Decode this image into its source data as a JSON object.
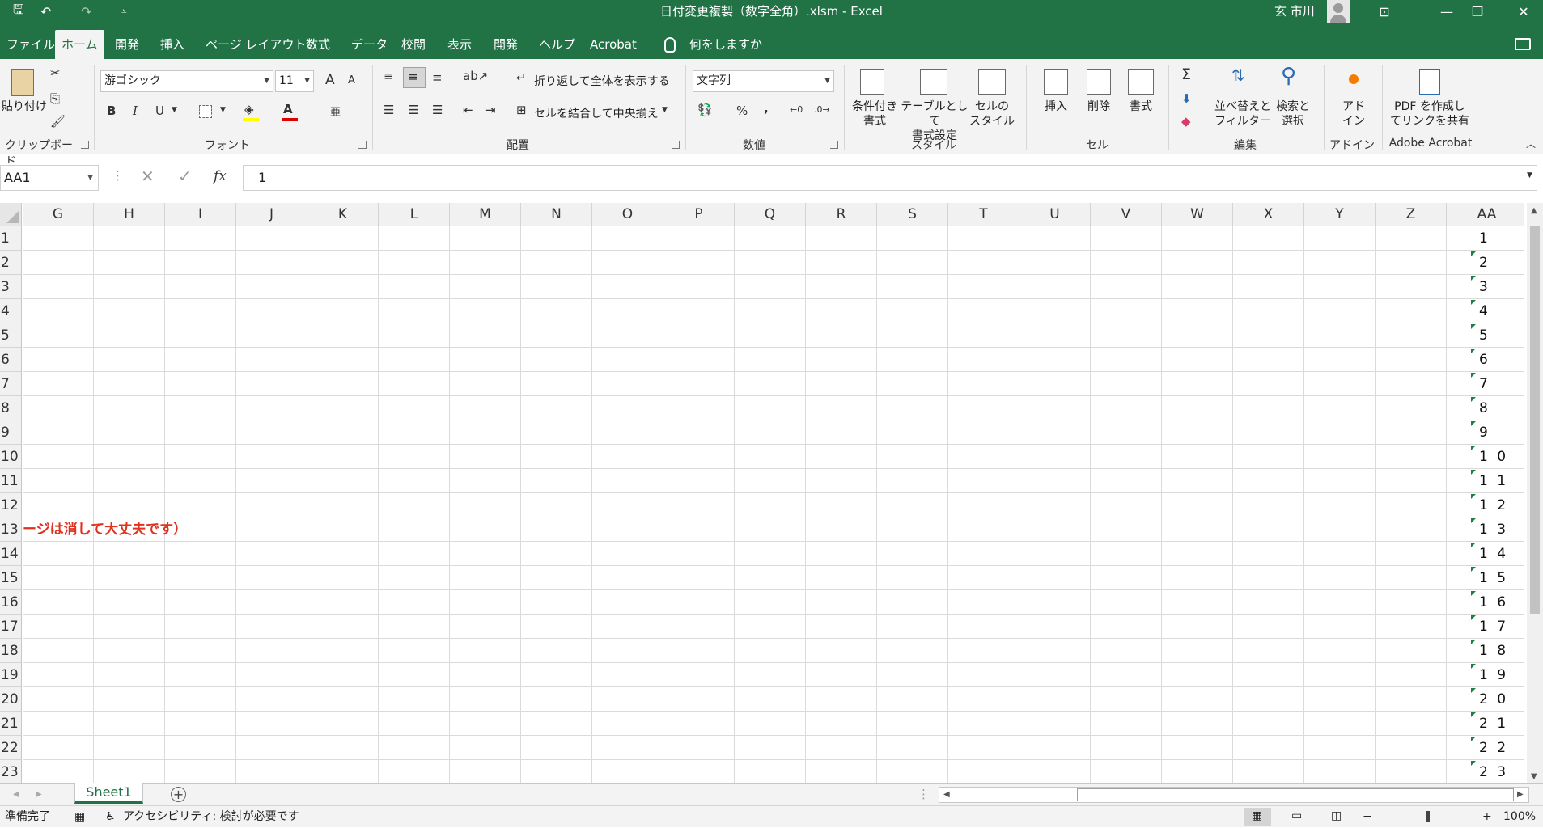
{
  "titlebar": {
    "title": "日付変更複製（数字全角）.xlsm  -  Excel",
    "user": "玄 市川",
    "qa_save": "🖫",
    "qa_undo": "↶",
    "qa_redo": "↷",
    "qa_more": "⩡",
    "win_ribbon_opts": "⊡",
    "win_minimize": "—",
    "win_restore": "❐",
    "win_close": "✕"
  },
  "tabs": [
    "ファイル",
    "ホーム",
    "開発",
    "挿入",
    "ページ レイアウト",
    "数式",
    "データ",
    "校閲",
    "表示",
    "開発",
    "ヘルプ",
    "Acrobat"
  ],
  "tell_me": "何をしますか",
  "ribbon": {
    "clipboard": {
      "paste": "貼り付け",
      "label": "クリップボード"
    },
    "font": {
      "name": "游ゴシック",
      "size": "11",
      "grow": "A",
      "shrink": "A",
      "bold": "B",
      "italic": "I",
      "underline": "U",
      "label": "フォント"
    },
    "alignment": {
      "wrap": "折り返して全体を表示する",
      "merge": "セルを結合して中央揃え",
      "label": "配置"
    },
    "number": {
      "format": "文字列",
      "percent": "%",
      "comma": ",",
      "label": "数値"
    },
    "styles": {
      "conditional": "条件付き\n書式",
      "table": "テーブルとして\n書式設定",
      "cell_styles": "セルの\nスタイル",
      "label": "スタイル"
    },
    "cells": {
      "insert": "挿入",
      "delete": "削除",
      "format": "書式",
      "label": "セル"
    },
    "editing": {
      "sigma": "Σ",
      "sort": "並べ替えと\nフィルター",
      "find": "検索と\n選択",
      "label": "編集"
    },
    "addin": {
      "addin": "アド\nイン",
      "label": "アドイン"
    },
    "acrobat": {
      "create": "PDF を作成し\nてリンクを共有",
      "label": "Adobe Acrobat"
    }
  },
  "formula_bar": {
    "name_box": "AA1",
    "fx": "fx",
    "value": "1"
  },
  "grid": {
    "columns": [
      "G",
      "H",
      "I",
      "J",
      "K",
      "L",
      "M",
      "N",
      "O",
      "P",
      "Q",
      "R",
      "S",
      "T",
      "U",
      "V",
      "W",
      "X",
      "Y",
      "Z",
      "AA"
    ],
    "rows": [
      "1",
      "2",
      "3",
      "4",
      "5",
      "6",
      "7",
      "8",
      "9",
      "10",
      "11",
      "12",
      "13",
      "14",
      "15",
      "16",
      "17",
      "18",
      "19",
      "20",
      "21",
      "22",
      "23"
    ],
    "aa_values": [
      "1",
      "2",
      "3",
      "4",
      "5",
      "6",
      "7",
      "8",
      "9",
      "1 0",
      "1 1",
      "1 2",
      "1 3",
      "1 4",
      "1 5",
      "1 6",
      "1 7",
      "1 8",
      "1 9",
      "2 0",
      "2 1",
      "2 2",
      "2 3"
    ],
    "red_note": "ージは消して大丈夫です）"
  },
  "sheet_tabs": {
    "active": "Sheet1",
    "add": "+"
  },
  "status": {
    "ready": "準備完了",
    "accessibility": "アクセシビリティ: 検討が必要です",
    "zoom": "100%",
    "zoom_minus": "−",
    "zoom_plus": "+"
  },
  "colors": {
    "excel_green": "#217346",
    "note_red": "#e0301e"
  }
}
